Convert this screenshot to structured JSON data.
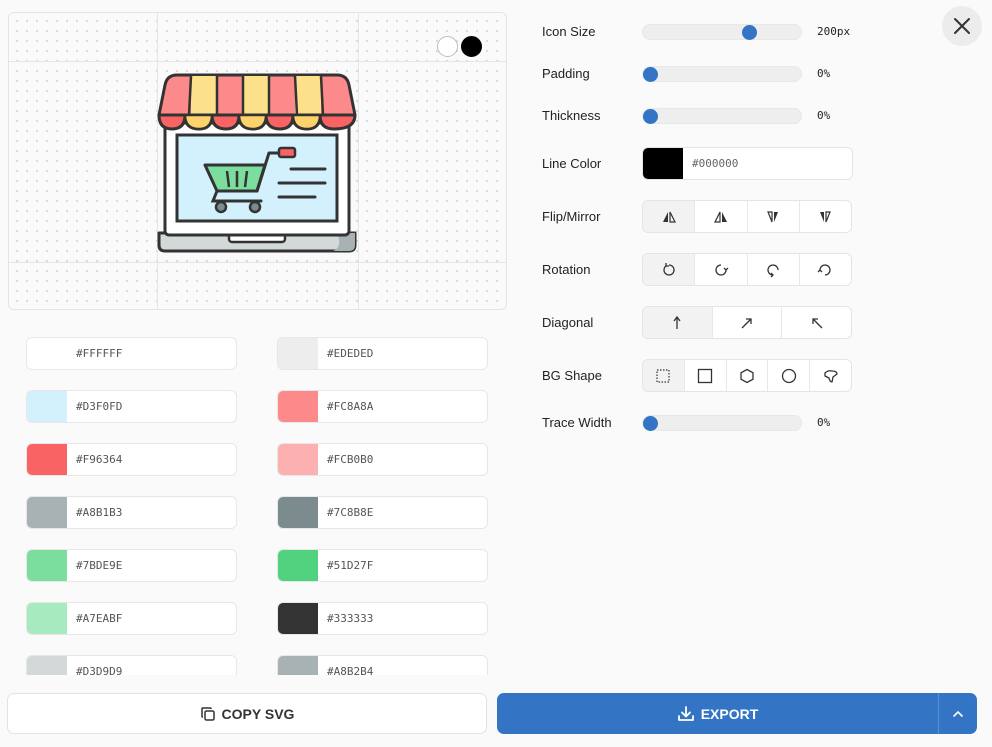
{
  "preview": {
    "bg_options": [
      "white",
      "black"
    ],
    "icon_name": "online-store-icon"
  },
  "palette": [
    {
      "hex": "#FFFFFF",
      "color": "#FFFFFF"
    },
    {
      "hex": "#EDEDED",
      "color": "#EDEDED"
    },
    {
      "hex": "#D3F0FD",
      "color": "#D3F0FD"
    },
    {
      "hex": "#FC8A8A",
      "color": "#FC8A8A"
    },
    {
      "hex": "#F96364",
      "color": "#F96364"
    },
    {
      "hex": "#FCB0B0",
      "color": "#FCB0B0"
    },
    {
      "hex": "#A8B1B3",
      "color": "#A8B1B3"
    },
    {
      "hex": "#7C8B8E",
      "color": "#7C8B8E"
    },
    {
      "hex": "#7BDE9E",
      "color": "#7BDE9E"
    },
    {
      "hex": "#51D27F",
      "color": "#51D27F"
    },
    {
      "hex": "#A7EABF",
      "color": "#A7EABF"
    },
    {
      "hex": "#333333",
      "color": "#333333"
    },
    {
      "hex": "#D3D9D9",
      "color": "#D3D9D9"
    },
    {
      "hex": "#A8B2B4",
      "color": "#A8B2B4"
    }
  ],
  "controls": {
    "icon_size": {
      "label": "Icon Size",
      "value": "200px",
      "fraction": 0.69
    },
    "padding": {
      "label": "Padding",
      "value": "0%",
      "fraction": 0
    },
    "thickness": {
      "label": "Thickness",
      "value": "0%",
      "fraction": 0
    },
    "line_color": {
      "label": "Line Color",
      "value": "#000000",
      "color": "#000000"
    },
    "flip": {
      "label": "Flip/Mirror",
      "options": [
        "flip-horizontal-left-icon",
        "flip-horizontal-right-icon",
        "flip-vertical-down-icon",
        "flip-vertical-up-icon"
      ]
    },
    "rotation": {
      "label": "Rotation",
      "options": [
        "rotate-ccw-icon",
        "rotate-cw-icon",
        "rotate-cw-down-icon",
        "rotate-ccw-down-icon"
      ]
    },
    "diagonal": {
      "label": "Diagonal",
      "options": [
        "arrow-up-icon",
        "arrow-up-right-icon",
        "arrow-up-left-icon"
      ]
    },
    "bg_shape": {
      "label": "BG Shape",
      "options": [
        "none-dotted-square-icon",
        "square-icon",
        "hexagon-icon",
        "circle-icon",
        "blob-icon"
      ]
    },
    "trace_width": {
      "label": "Trace Width",
      "value": "0%",
      "fraction": 0
    }
  },
  "footer": {
    "copy_label": "COPY SVG",
    "export_label": "EXPORT"
  },
  "colors": {
    "accent": "#3474C4"
  }
}
